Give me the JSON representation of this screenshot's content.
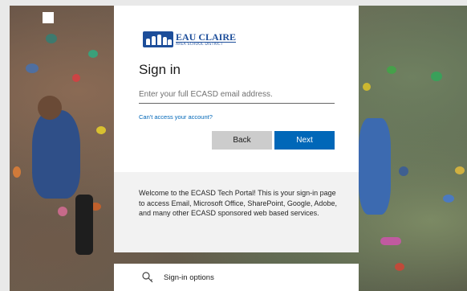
{
  "logo": {
    "name": "EAU CLAIRE",
    "subtitle": "AREA SCHOOL DISTRICT"
  },
  "signin": {
    "title": "Sign in",
    "email_placeholder": "Enter your full ECASD email address.",
    "email_value": "",
    "cant_access": "Can't access your account?",
    "back_label": "Back",
    "next_label": "Next"
  },
  "welcome": {
    "text": "Welcome to the ECASD Tech Portal! This is your sign-in page to access Email, Microsoft Office, SharePoint, Google, Adobe, and many other ECASD sponsored web based services."
  },
  "options": {
    "label": "Sign-in options",
    "icon": "key-search-icon"
  },
  "colors": {
    "accent": "#0067b8",
    "brand": "#1d4e9a",
    "back_button": "#cccccc",
    "welcome_bg": "#f2f2f2"
  }
}
